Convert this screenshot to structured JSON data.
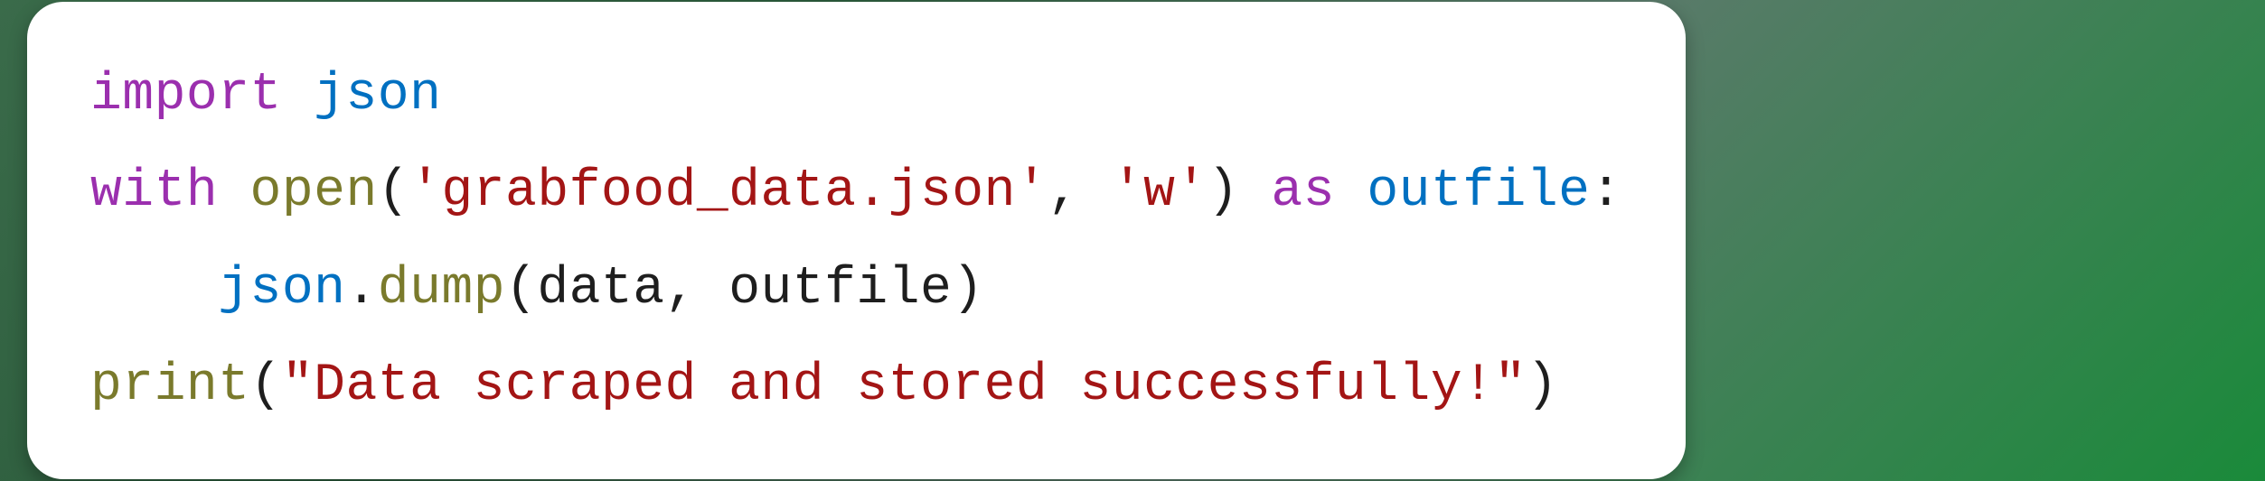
{
  "code": {
    "line1": {
      "kw_import": "import",
      "space1": " ",
      "module": "json"
    },
    "line2": {
      "kw_with": "with",
      "space1": " ",
      "func_open": "open",
      "paren_open": "(",
      "string_file": "'grabfood_data.json'",
      "comma": ",",
      "space2": " ",
      "string_mode": "'w'",
      "paren_close": ")",
      "space3": " ",
      "kw_as": "as",
      "space4": " ",
      "var_outfile": "outfile",
      "colon": ":"
    },
    "line3": {
      "indent": "    ",
      "module_json": "json",
      "dot": ".",
      "func_dump": "dump",
      "paren_open": "(",
      "var_data": "data",
      "comma": ",",
      "space1": " ",
      "var_outfile": "outfile",
      "paren_close": ")"
    },
    "line4": {
      "func_print": "print",
      "paren_open": "(",
      "string_msg": "\"Data scraped and stored successfully!\"",
      "paren_close": ")"
    }
  }
}
